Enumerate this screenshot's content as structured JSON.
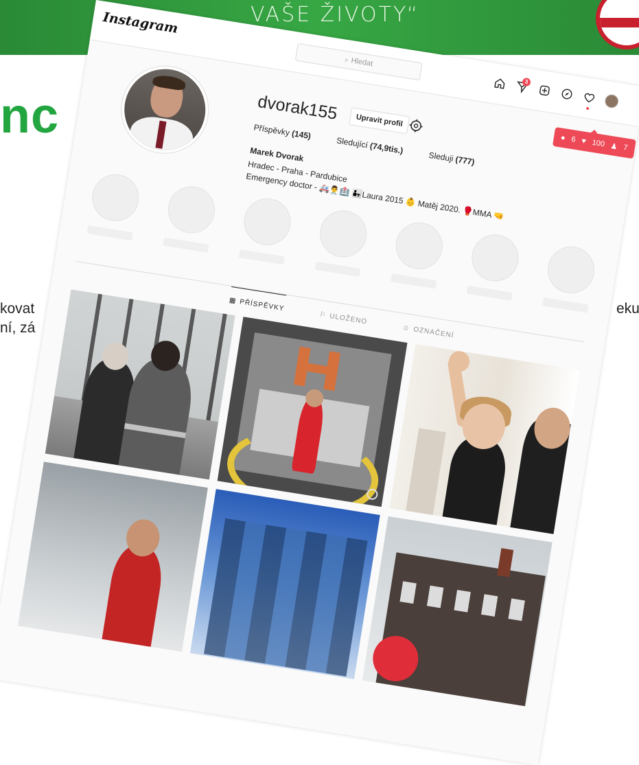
{
  "slide": {
    "slogan": "VAŠE ŽIVOTY“",
    "heading": "nc",
    "text_left_1": "kovat",
    "text_left_2": "ní, zá",
    "text_right_1": "eku",
    "colors": {
      "banner": "#2e9a3c",
      "heading": "#23a540",
      "logo_ring": "#c9202e"
    }
  },
  "instagram": {
    "logo": "Instagram",
    "search": {
      "placeholder": "Hledat",
      "icon": "search-icon"
    },
    "nav": {
      "icons": [
        "home-icon",
        "direct-icon",
        "new-post-icon",
        "explore-icon",
        "heart-icon",
        "profile-avatar"
      ],
      "direct_badge": "3"
    },
    "notifications": {
      "comments": "6",
      "likes": "100",
      "followers": "7"
    },
    "profile": {
      "username": "dvorak155",
      "edit_button": "Upravit profil",
      "stats": {
        "posts_label": "Příspěvky",
        "posts_value": "(145)",
        "followers_label": "Sledující",
        "followers_value": "(74,9tis.)",
        "following_label": "Sleduji",
        "following_value": "(777)"
      },
      "full_name": "Marek Dvorak",
      "bio_line_1": "Hradec - Praha - Pardubice",
      "bio_line_2": "Emergency doctor - 🚑👨‍⚕️🏥 👨‍👧Laura 2015 👶 Matěj 2020. 🥊MMA 🤜"
    },
    "highlights_count": 7,
    "tabs": [
      {
        "label": "PŘÍSPĚVKY",
        "icon": "grid-icon",
        "active": true
      },
      {
        "label": "ULOŽENO",
        "icon": "bookmark-icon",
        "active": false
      },
      {
        "label": "OZNAČENÍ",
        "icon": "tag-icon",
        "active": false
      }
    ],
    "accent": "#ed4956"
  }
}
